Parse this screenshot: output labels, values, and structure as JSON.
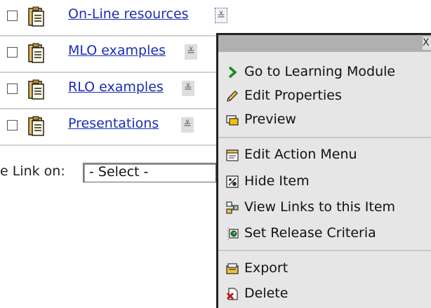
{
  "items_list": [
    {
      "label": "On-Line resources",
      "menu_glyph": "≚"
    },
    {
      "label": "MLO examples",
      "menu_glyph": "≚"
    },
    {
      "label": "RLO examples",
      "menu_glyph": "≚"
    },
    {
      "label": "Presentations",
      "menu_glyph": "≚"
    }
  ],
  "link_on": {
    "label": "e Link on:",
    "select_value": "- Select -"
  },
  "menu": {
    "close_glyph": "X",
    "items": [
      {
        "label": "Go to Learning Module",
        "icon": "arrow-right-icon"
      },
      {
        "label": "Edit Properties",
        "icon": "pencil-icon"
      },
      {
        "label": "Preview",
        "icon": "preview-window-icon"
      },
      {
        "label": "Edit Action Menu",
        "icon": "menu-edit-icon"
      },
      {
        "label": "Hide Item",
        "icon": "hide-icon"
      },
      {
        "label": "View Links to this Item",
        "icon": "links-icon"
      },
      {
        "label": "Set Release Criteria",
        "icon": "release-criteria-icon"
      },
      {
        "label": "Export",
        "icon": "export-icon"
      },
      {
        "label": "Delete",
        "icon": "delete-icon"
      }
    ]
  },
  "colors": {
    "link": "#1a2db4",
    "menu_bg": "#e6e6e6",
    "title_bar": "#b0b0b0",
    "accent_green": "#1a8a1a",
    "delete_red": "#c0161c"
  }
}
